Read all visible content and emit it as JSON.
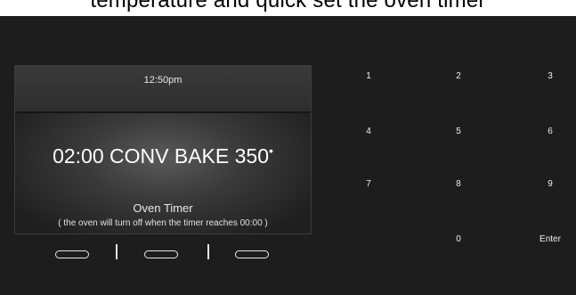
{
  "page_header": {
    "cropped_text": "temperature and quick set the oven timer"
  },
  "display": {
    "clock": "12:50pm",
    "main": {
      "time": "02:00",
      "mode": "CONV BAKE",
      "temperature": "350",
      "degree_symbol": "•"
    },
    "title": "Oven Timer",
    "note": "( the oven will turn off when the timer reaches 00:00 )"
  },
  "keypad": {
    "k1": "1",
    "k2": "2",
    "k3": "3",
    "k4": "4",
    "k5": "5",
    "k6": "6",
    "k7": "7",
    "k8": "8",
    "k9": "9",
    "k0": "0",
    "enter": "Enter"
  },
  "colors": {
    "panel": "#1d1d1d",
    "text": "#ffffff"
  }
}
